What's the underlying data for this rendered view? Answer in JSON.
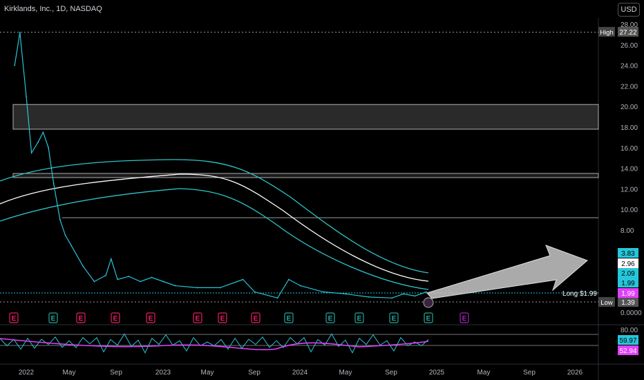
{
  "header": {
    "title": "Kirklands, Inc., 1D, NASDAQ",
    "currency": "USD"
  },
  "colors": {
    "price": "#26c6da",
    "rsi_ma": "#e040fb",
    "arrow": "#c8c8c8",
    "band": "#2ec4c8",
    "center": "#ffffff"
  },
  "chart_data": {
    "type": "line",
    "x_ticks": [
      "2022",
      "May",
      "Sep",
      "2023",
      "May",
      "Sep",
      "2024",
      "May",
      "Sep",
      "2025",
      "May",
      "Sep",
      "2026"
    ],
    "y_ticks": [
      "28.00",
      "26.00",
      "24.00",
      "22.00",
      "20.00",
      "18.00",
      "16.00",
      "14.00",
      "12.00",
      "10.00",
      "8.00",
      "0.0000"
    ],
    "ylim": [
      0,
      28
    ],
    "price_points": [
      {
        "x": "2021-12",
        "y": 24.0
      },
      {
        "x": "2021-12-15",
        "y": 27.2
      },
      {
        "x": "2022-01",
        "y": 21.0
      },
      {
        "x": "2022-01-15",
        "y": 15.5
      },
      {
        "x": "2022-02",
        "y": 16.5
      },
      {
        "x": "2022-02-15",
        "y": 17.5
      },
      {
        "x": "2022-03",
        "y": 16.0
      },
      {
        "x": "2022-03-15",
        "y": 12.5
      },
      {
        "x": "2022-04",
        "y": 9.0
      },
      {
        "x": "2022-04-15",
        "y": 7.5
      },
      {
        "x": "2022-05",
        "y": 6.5
      },
      {
        "x": "2022-06",
        "y": 4.5
      },
      {
        "x": "2022-07",
        "y": 3.0
      },
      {
        "x": "2022-08",
        "y": 3.6
      },
      {
        "x": "2022-08-15",
        "y": 5.2
      },
      {
        "x": "2022-09",
        "y": 3.2
      },
      {
        "x": "2022-10",
        "y": 3.5
      },
      {
        "x": "2022-11",
        "y": 3.0
      },
      {
        "x": "2022-12",
        "y": 3.4
      },
      {
        "x": "2023-01",
        "y": 3.0
      },
      {
        "x": "2023-02",
        "y": 2.6
      },
      {
        "x": "2023-04",
        "y": 2.4
      },
      {
        "x": "2023-06",
        "y": 2.4
      },
      {
        "x": "2023-08",
        "y": 3.2
      },
      {
        "x": "2023-09",
        "y": 2.0
      },
      {
        "x": "2023-11",
        "y": 1.4
      },
      {
        "x": "2023-12",
        "y": 3.2
      },
      {
        "x": "2024-01",
        "y": 2.6
      },
      {
        "x": "2024-03",
        "y": 2.0
      },
      {
        "x": "2024-05",
        "y": 1.8
      },
      {
        "x": "2024-07",
        "y": 1.5
      },
      {
        "x": "2024-09",
        "y": 1.4
      },
      {
        "x": "2024-10",
        "y": 1.8
      },
      {
        "x": "2024-11",
        "y": 1.6
      },
      {
        "x": "2024-12",
        "y": 1.99
      }
    ],
    "zones": [
      {
        "low": 17.8,
        "high": 20.2
      },
      {
        "low": 13.1,
        "high": 13.5
      }
    ],
    "level_line": 9.2,
    "high_line": 27.22,
    "low_line": 1.39,
    "price_labels": [
      {
        "label": "High",
        "value": "27.22"
      },
      {
        "label": "Low",
        "value": "1.39"
      },
      {
        "label": "Long",
        "value": "$1.99"
      }
    ],
    "right_labels": [
      "3.83",
      "2.96",
      "2.09",
      "1.99",
      "1.99"
    ],
    "earnings_markers": [
      "E",
      "E",
      "E",
      "E",
      "E",
      "E",
      "E",
      "E",
      "E",
      "E",
      "E",
      "E",
      "E",
      "E"
    ],
    "rsi": {
      "y_ticks": [
        "80.00"
      ],
      "value": "59.97",
      "ma_value": "52.94"
    }
  }
}
